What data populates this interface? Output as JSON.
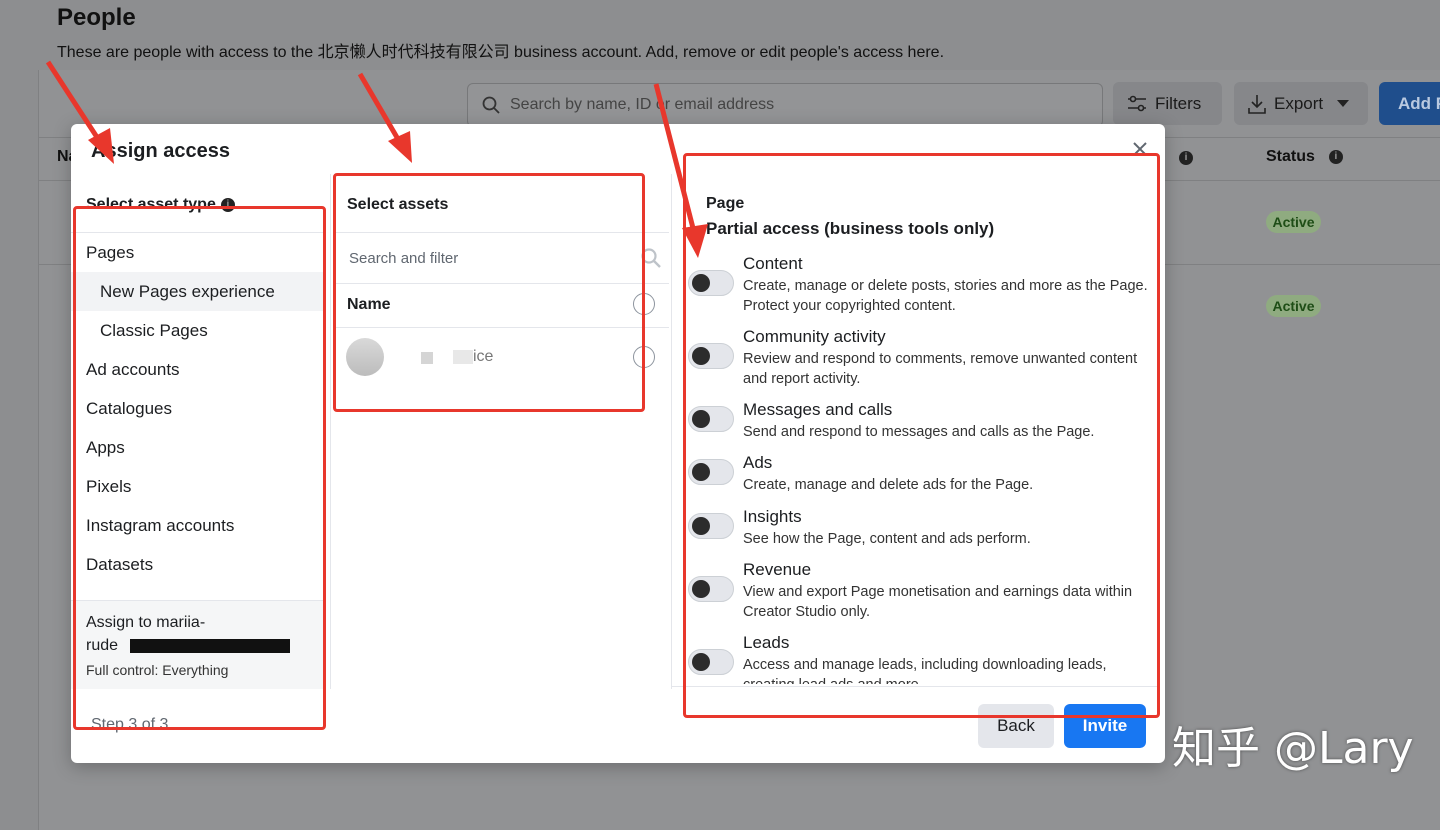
{
  "background": {
    "title": "People",
    "description": "These are people with access to the 北京懒人时代科技有限公司 business account. Add, remove or edit people's access here.",
    "search_placeholder": "Search by name, ID or email address",
    "filters_label": "Filters",
    "export_label": "Export",
    "add_label": "Add P",
    "status_header": "Status",
    "name_header_fragment": "Na",
    "badges": [
      "Active",
      "Active"
    ]
  },
  "modal": {
    "title": "Assign access",
    "col1": {
      "heading": "Select asset type",
      "items": [
        "Pages",
        "New Pages experience",
        "Classic Pages",
        "Ad accounts",
        "Catalogues",
        "Apps",
        "Pixels",
        "Instagram accounts",
        "Datasets"
      ],
      "assign_line1": "Assign to mariia-",
      "assign_line2": "rude",
      "assign_line3": "Full control: Everything",
      "step": "Step 3 of 3"
    },
    "col2": {
      "heading": "Select assets",
      "filter_placeholder": "Search and filter",
      "name_header": "Name",
      "asset_name": "ice"
    },
    "col3": {
      "title": "Page",
      "subtitle": "Partial access (business tools only)",
      "permissions": [
        {
          "name": "Content",
          "desc": "Create, manage or delete posts, stories and more as the Page. Protect your copyrighted content."
        },
        {
          "name": "Community activity",
          "desc": "Review and respond to comments, remove unwanted content and report activity."
        },
        {
          "name": "Messages and calls",
          "desc": "Send and respond to messages and calls as the Page."
        },
        {
          "name": "Ads",
          "desc": "Create, manage and delete ads for the Page."
        },
        {
          "name": "Insights",
          "desc": "See how the Page, content and ads perform."
        },
        {
          "name": "Revenue",
          "desc": "View and export Page monetisation and earnings data within Creator Studio only."
        },
        {
          "name": "Leads",
          "desc": "Access and manage leads, including downloading leads, creating lead ads and more."
        }
      ]
    },
    "back_label": "Back",
    "invite_label": "Invite"
  },
  "watermark": "知乎 @Lary",
  "colors": {
    "accent": "#1877f2",
    "highlight": "#e8372c",
    "active_badge": "#8fab80"
  }
}
